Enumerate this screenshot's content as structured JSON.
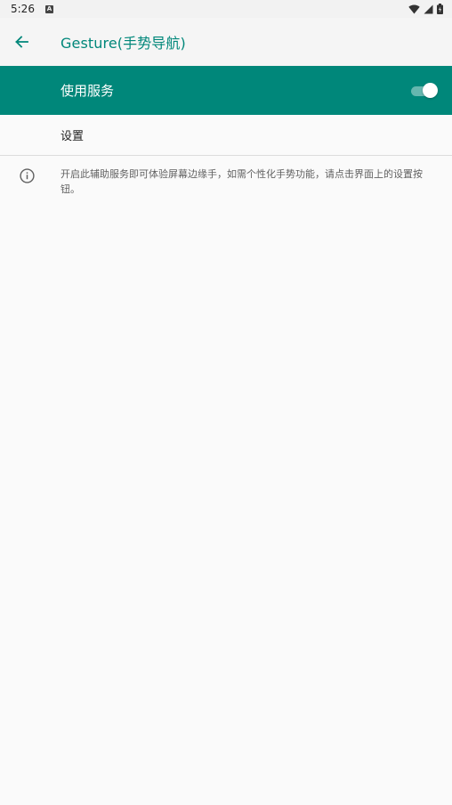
{
  "status_bar": {
    "time": "5:26",
    "notif_letter": "A"
  },
  "app_bar": {
    "title": "Gesture(手势导航)"
  },
  "master_switch": {
    "label": "使用服务",
    "on": true
  },
  "settings": {
    "label": "设置"
  },
  "info": {
    "text": "开启此辅助服务即可体验屏幕边缘手，如需个性化手势功能，请点击界面上的设置按钮。"
  },
  "colors": {
    "accent": "#00877a",
    "background": "#fafafa"
  }
}
